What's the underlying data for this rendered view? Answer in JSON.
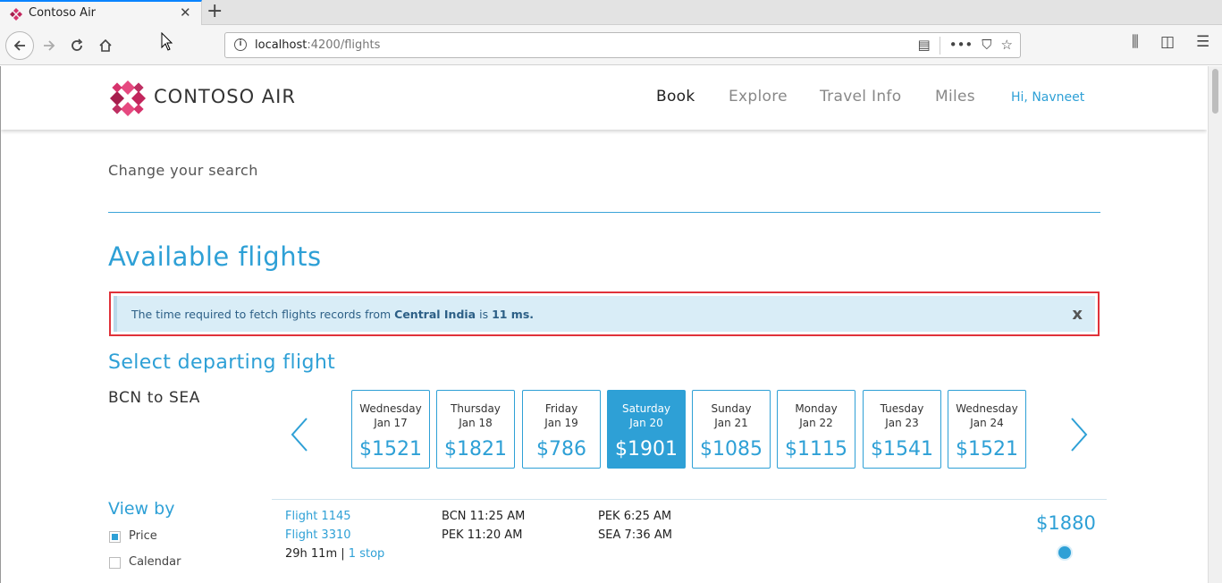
{
  "browser": {
    "tab_title": "Contoso Air",
    "url_host": "localhost",
    "url_path": ":4200/flights"
  },
  "site": {
    "logo_text": "CONTOSO AIR",
    "nav": [
      "Book",
      "Explore",
      "Travel Info",
      "Miles"
    ],
    "greeting": "Hi, Navneet",
    "brand_color": "#2ea0d6",
    "logo_color": "#d6336c"
  },
  "search": {
    "change_label": "Change your search"
  },
  "results": {
    "heading": "Available flights",
    "alert": {
      "prefix": "The time required to fetch flights records from ",
      "region": "Central India",
      "middle": " is ",
      "duration": "11 ms.",
      "close": "x"
    },
    "select_heading": "Select departing flight",
    "route": "BCN to SEA",
    "days": [
      {
        "day": "Wednesday",
        "date": "Jan 17",
        "price": "$1521",
        "selected": false
      },
      {
        "day": "Thursday",
        "date": "Jan 18",
        "price": "$1821",
        "selected": false
      },
      {
        "day": "Friday",
        "date": "Jan 19",
        "price": "$786",
        "selected": false
      },
      {
        "day": "Saturday",
        "date": "Jan 20",
        "price": "$1901",
        "selected": true
      },
      {
        "day": "Sunday",
        "date": "Jan 21",
        "price": "$1085",
        "selected": false
      },
      {
        "day": "Monday",
        "date": "Jan 22",
        "price": "$1115",
        "selected": false
      },
      {
        "day": "Tuesday",
        "date": "Jan 23",
        "price": "$1541",
        "selected": false
      },
      {
        "day": "Wednesday",
        "date": "Jan 24",
        "price": "$1521",
        "selected": false
      }
    ],
    "view_by": {
      "label": "View by",
      "options": [
        {
          "label": "Price",
          "checked": true
        },
        {
          "label": "Calendar",
          "checked": false
        }
      ]
    },
    "flight": {
      "segments": [
        {
          "name": "Flight 1145",
          "depart": "BCN 11:25 AM",
          "arrive": "PEK 6:25 AM"
        },
        {
          "name": "Flight 3310",
          "depart": "PEK 11:20 AM",
          "arrive": "SEA 7:36 AM"
        }
      ],
      "duration": "29h 11m",
      "separator": "|",
      "stops": "1 stop",
      "price": "$1880"
    }
  }
}
